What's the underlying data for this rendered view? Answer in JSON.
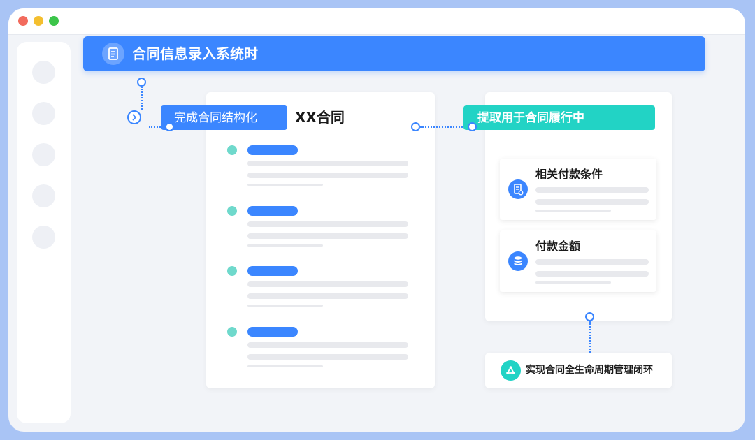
{
  "window": {
    "controls": [
      "close",
      "minimize",
      "maximize"
    ],
    "sidebar_item_count": 5
  },
  "banner": {
    "icon": "document-icon",
    "title": "合同信息录入系统时"
  },
  "left_panel": {
    "tag_label": "完成合同结构化",
    "expand_icon": "chevron-right-icon",
    "document_title": "XX合同",
    "section_count": 4
  },
  "right_panel": {
    "tag_label": "提取用于合同履行中",
    "cards": [
      {
        "title": "相关付款条件",
        "icon": "document-settings-icon"
      },
      {
        "title": "付款金额",
        "icon": "coin-stack-icon"
      }
    ]
  },
  "bottom": {
    "icon": "recycle-icon",
    "text": "实现合同全生命周期管理闭环"
  },
  "colors": {
    "accent_blue": "#3b86ff",
    "accent_teal": "#22d3c5",
    "page_bg": "#f2f4f8"
  }
}
